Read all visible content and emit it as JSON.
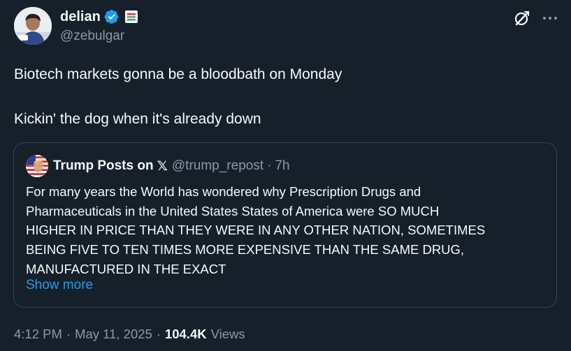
{
  "author": {
    "display_name": "delian",
    "handle": "@zebulgar",
    "verified": true,
    "affiliate_badge": "flag-badge"
  },
  "toolbar": {
    "grok_icon": "grok-icon",
    "more_icon": "more-options-icon"
  },
  "tweet": {
    "lines": [
      "Biotech markets gonna be a bloodbath on Monday",
      "Kickin' the dog when it's already down"
    ]
  },
  "quote": {
    "display_name": "Trump Posts on",
    "x_glyph": "𝕏",
    "handle": "@trump_repost",
    "separator": "·",
    "time": "7h",
    "body_lines": [
      "For many years the World has wondered why Prescription Drugs and",
      "Pharmaceuticals in the United States States of America were SO MUCH",
      "HIGHER IN PRICE THAN THEY WERE IN ANY OTHER NATION, SOMETIMES",
      "BEING FIVE TO TEN TIMES MORE EXPENSIVE THAN THE SAME DRUG,",
      "MANUFACTURED IN THE EXACT"
    ],
    "show_more": "Show more"
  },
  "meta": {
    "time": "4:12 PM",
    "separator": "·",
    "date": "May 11, 2025",
    "views_count": "104.4K",
    "views_label": "Views"
  },
  "colors": {
    "background": "#15202b",
    "text_primary": "#f7f9f9",
    "text_secondary": "#8b98a5",
    "accent_blue": "#1d9bf0",
    "border": "#38444d"
  }
}
